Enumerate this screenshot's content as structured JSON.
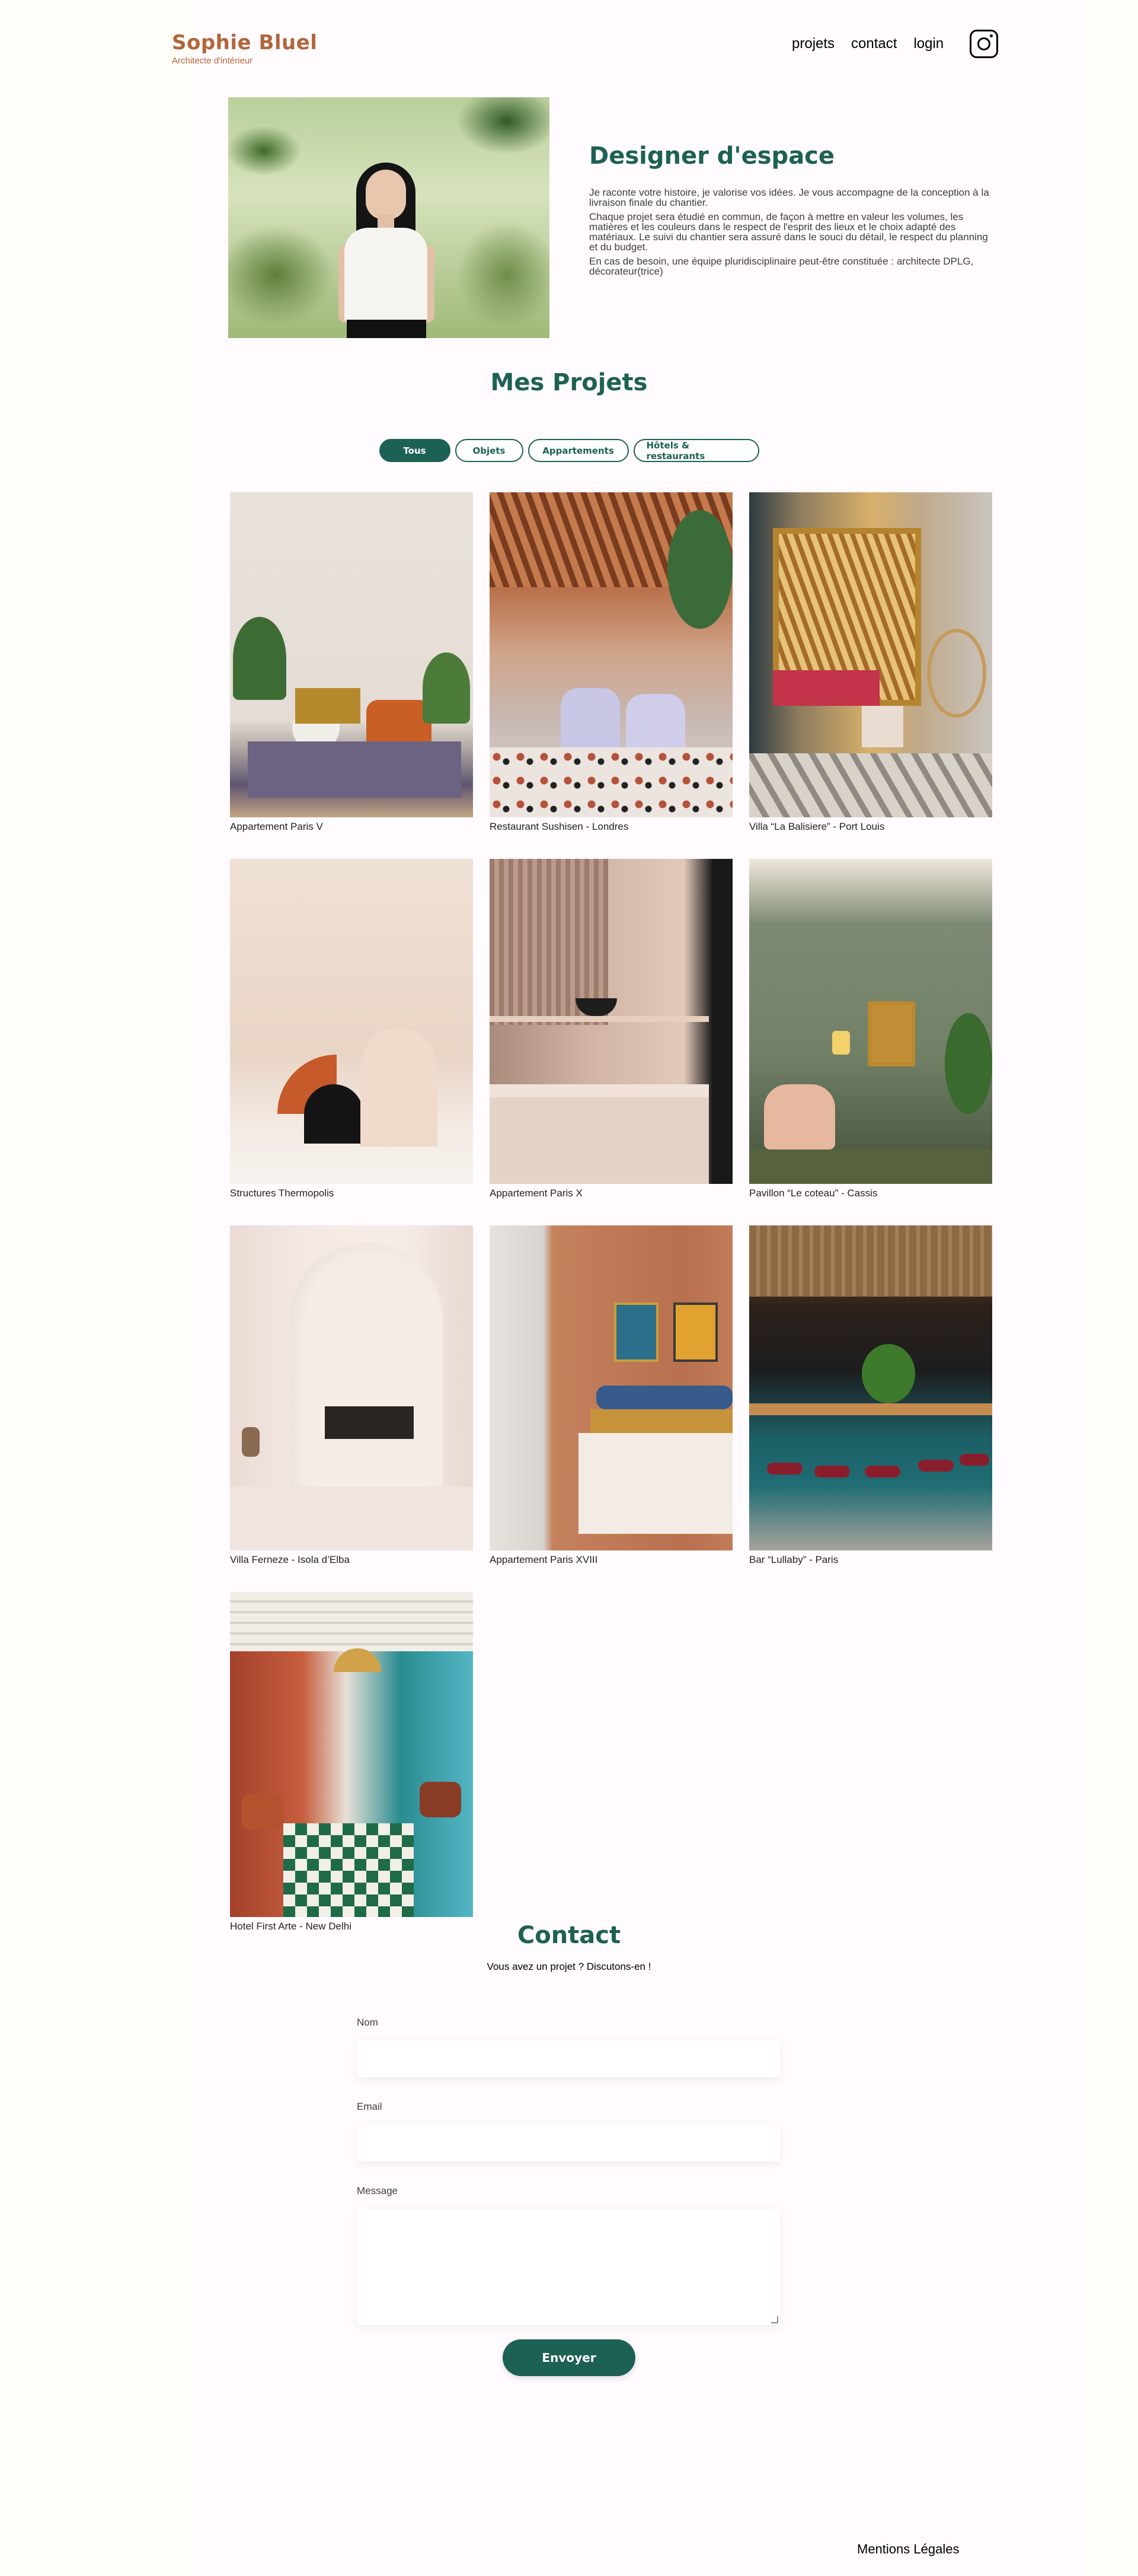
{
  "header": {
    "brand_name": "Sophie Bluel",
    "brand_subtitle": "Architecte d'intérieur",
    "nav": [
      "projets",
      "contact",
      "login"
    ],
    "social_icon": "instagram-icon"
  },
  "intro": {
    "title": "Designer d'espace",
    "paragraphs": [
      "Je raconte votre histoire, je valorise vos idées. Je vous accompagne de la conception à la livraison finale du chantier.",
      "Chaque projet sera étudié en commun, de façon à mettre en valeur les volumes, les matières et les couleurs dans le respect de l'esprit des lieux et le choix adapté des matériaux. Le suivi du chantier sera assuré dans le souci du détail, le respect du planning et du budget.",
      "En cas de besoin, une équipe pluridisciplinaire peut-être constituée : architecte DPLG, décorateur(trice)"
    ]
  },
  "projects": {
    "title": "Mes Projets",
    "filters": [
      "Tous",
      "Objets",
      "Appartements",
      "Hôtels & restaurants"
    ],
    "active_filter": "Tous",
    "items": [
      "Appartement Paris V",
      "Restaurant Sushisen - Londres",
      "Villa “La Balisiere” - Port Louis",
      "Structures Thermopolis",
      "Appartement Paris X",
      "Pavillon “Le coteau” - Cassis",
      "Villa Ferneze - Isola d’Elba",
      "Appartement Paris XVIII",
      "Bar “Lullaby” - Paris",
      "Hotel First Arte - New Delhi"
    ]
  },
  "contact": {
    "title": "Contact",
    "subtitle": "Vous avez un projet ? Discutons-en !",
    "fields": {
      "name_label": "Nom",
      "email_label": "Email",
      "message_label": "Message"
    },
    "submit_label": "Envoyer"
  },
  "footer": {
    "legal_link": "Mentions Légales"
  },
  "colors": {
    "brand": "#B1663C",
    "accent": "#1D6154",
    "background": "#FFFEF8"
  }
}
